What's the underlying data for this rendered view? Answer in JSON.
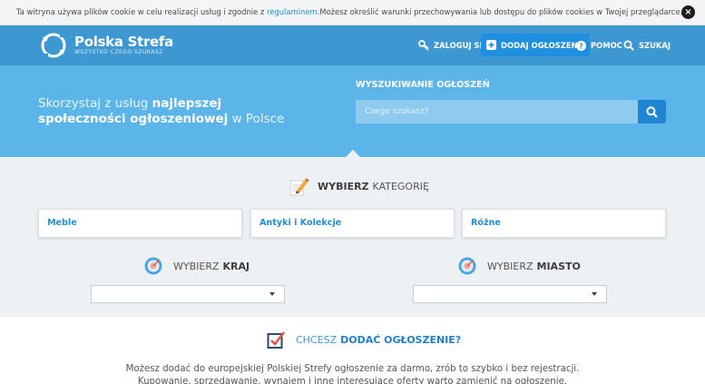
{
  "cookie": {
    "text_before": "Ta witryna używa plików cookie w celu realizacji usług i zgodnie z ",
    "link": "regulaminem",
    "text_after": ".Możesz określić warunki przechowywania lub dostępu do plików cookies w Twojej przeglądarce."
  },
  "header": {
    "logo_name": "Polska Strefa",
    "logo_tagline": "WSZYSTKO CZEGO SZUKASZ",
    "nav": {
      "login": "ZALOGUJ SIĘ",
      "add": "DODAJ OGŁOSZENIE",
      "help": "POMOC",
      "search": "SZUKAJ"
    }
  },
  "hero": {
    "text_1": "Skorzystaj z usług ",
    "text_bold": "najlepszej społeczności ogłoszeniowej",
    "text_2": " w Polsce",
    "search_title": "WYSZUKIWANIE OGŁOSZEŃ",
    "search_placeholder": "Czego szukasz?"
  },
  "categories": {
    "title_bold": "WYBIERZ",
    "title_rest": "KATEGORIĘ",
    "items": [
      "Meble",
      "Antyki i Kolekcje",
      "Różne"
    ]
  },
  "location": {
    "country_label": "WYBIERZ",
    "country_bold": "KRAJ",
    "city_label": "WYBIERZ",
    "city_bold": "MIASTO"
  },
  "add_section": {
    "title_1": "CHCESZ",
    "title_bold": "DODAĆ OGŁOSZENIE?",
    "desc_1": "Możesz dodać do europejskiej Polskiej Strefy ogłoszenie za darmo, zrób to szybko i bez rejestracji.",
    "desc_2": "Kupowanie, sprzedawanie, wynajem i inne interesujące oferty warto zamienić na ogłoszenie."
  },
  "colors": {
    "header": "#3d97d1",
    "hero": "#5bb5e8",
    "accent": "#1f8fd6",
    "section_bg": "#eef1f4"
  },
  "icons": [
    "close-icon",
    "logo-icon",
    "key-icon",
    "plus-icon",
    "help-icon",
    "search-icon",
    "pencil-icon",
    "location-icon",
    "checkbox-icon"
  ]
}
